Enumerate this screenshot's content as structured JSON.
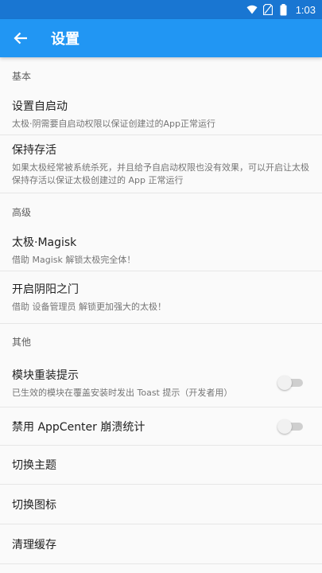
{
  "status_bar": {
    "time": "1:03"
  },
  "app_bar": {
    "title": "设置"
  },
  "sections": {
    "basic": {
      "header": "基本"
    },
    "advanced": {
      "header": "高级"
    },
    "other": {
      "header": "其他"
    }
  },
  "items": {
    "autostart": {
      "title": "设置自启动",
      "summary": "太极·阴需要自启动权限以保证创建过的App正常运行"
    },
    "keepalive": {
      "title": "保持存活",
      "summary": "如果太极经常被系统杀死，并且给予自启动权限也没有效果，可以开启让太极保持存活以保证太极创建过的 App 正常运行"
    },
    "magisk": {
      "title": "太极·Magisk",
      "summary": "借助 Magisk 解锁太极完全体！"
    },
    "yinyang": {
      "title": "开启阴阳之门",
      "summary": "借助 设备管理员 解锁更加强大的太极！"
    },
    "reinstall_hint": {
      "title": "模块重装提示",
      "summary": "已生效的模块在覆盖安装时发出 Toast 提示（开发者用）",
      "enabled": false
    },
    "appcenter": {
      "title": "禁用 AppCenter 崩溃统计",
      "enabled": false
    },
    "theme": {
      "title": "切换主题"
    },
    "icon": {
      "title": "切换图标"
    },
    "cache": {
      "title": "清理缓存"
    }
  },
  "colors": {
    "primary": "#2196f3",
    "primary_dark": "#1976d2"
  }
}
